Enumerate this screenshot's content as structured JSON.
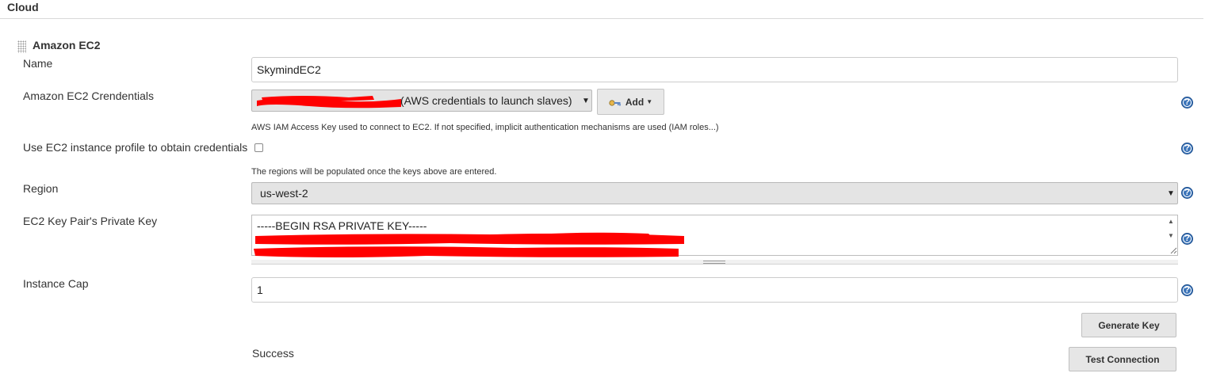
{
  "section": {
    "title": "Cloud"
  },
  "cloud": {
    "header": "Amazon EC2"
  },
  "fields": {
    "name": {
      "label": "Name",
      "value": "SkymindEC2"
    },
    "credentials": {
      "label": "Amazon EC2 Crendentials",
      "selected": "(AWS credentials to launch slaves)",
      "help": "AWS IAM Access Key used to connect to EC2. If not specified, implicit authentication mechanisms are used (IAM roles...)"
    },
    "instance_profile": {
      "label": "Use EC2 instance profile to obtain credentials",
      "checked": false,
      "help": "The regions will be populated once the keys above are entered."
    },
    "region": {
      "label": "Region",
      "selected": "us-west-2"
    },
    "private_key": {
      "label": "EC2 Key Pair's Private Key",
      "value": "-----BEGIN RSA PRIVATE KEY-----"
    },
    "instance_cap": {
      "label": "Instance Cap",
      "value": "1"
    }
  },
  "buttons": {
    "add": "Add",
    "generate_key": "Generate Key",
    "test_connection": "Test Connection"
  },
  "status": "Success",
  "icons": {
    "help": "help-icon",
    "key": "key-icon",
    "drag": "drag-handle-icon"
  },
  "colors": {
    "redaction": "#ff0000",
    "help_icon": "#3a73b8"
  }
}
